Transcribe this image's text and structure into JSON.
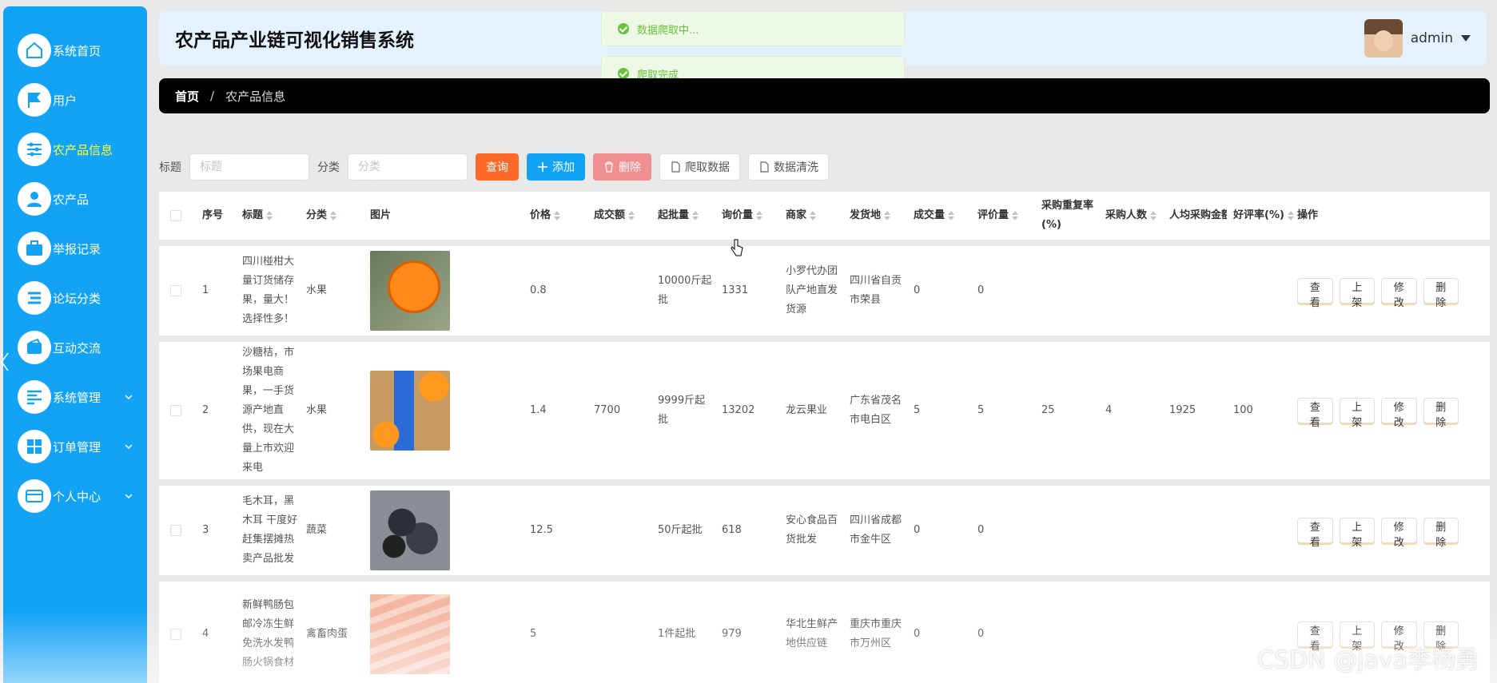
{
  "app": {
    "title": "农产品产业链可视化销售系统"
  },
  "user": {
    "name": "admin"
  },
  "sidebar": {
    "items": [
      {
        "label": "系统首页",
        "icon": "home-icon"
      },
      {
        "label": "用户",
        "icon": "flag-icon"
      },
      {
        "label": "农产品信息",
        "icon": "sliders-icon",
        "active": true
      },
      {
        "label": "农产品",
        "icon": "person-icon"
      },
      {
        "label": "举报记录",
        "icon": "briefcase-icon"
      },
      {
        "label": "论坛分类",
        "icon": "list-icon"
      },
      {
        "label": "互动交流",
        "icon": "wallet-icon"
      },
      {
        "label": "系统管理",
        "icon": "menu-icon",
        "expandable": true
      },
      {
        "label": "订单管理",
        "icon": "grid-icon",
        "expandable": true
      },
      {
        "label": "个人中心",
        "icon": "card-icon",
        "expandable": true
      }
    ]
  },
  "breadcrumb": {
    "home": "首页",
    "sep": "/",
    "current": "农产品信息"
  },
  "toasts": [
    {
      "text": "数据爬取中..."
    },
    {
      "text": "爬取完成"
    }
  ],
  "search": {
    "title_label": "标题",
    "title_placeholder": "标题",
    "category_label": "分类",
    "category_placeholder": "分类",
    "query": "查询",
    "add": "添加",
    "delete": "删除",
    "crawl": "爬取数据",
    "clean": "数据清洗"
  },
  "table": {
    "headers": {
      "no": "序号",
      "title": "标题",
      "category": "分类",
      "image": "图片",
      "price": "价格",
      "deal_amount": "成交额",
      "min_batch": "起批量",
      "inquiries": "询价量",
      "merchant": "商家",
      "ship_from": "发货地",
      "volume": "成交量",
      "reviews": "评价量",
      "repurchase": "采购重复率(%)",
      "buyers": "采购人数",
      "avg_amount": "人均采购金额",
      "good_rate": "好评率(%)",
      "ops": "操作"
    },
    "ops": {
      "view": "查看",
      "shelf": "上架",
      "edit": "修改",
      "delete": "删除"
    },
    "rows": [
      {
        "no": "1",
        "title": "四川椪柑大量订货储存果，量大！选择性多！",
        "category": "水果",
        "price": "0.8",
        "deal_amount": "",
        "min_batch": "10000斤起批",
        "inquiries": "1331",
        "merchant": "小罗代办团队产地直发货源",
        "ship_from": "四川省自贡市荣县",
        "volume": "0",
        "reviews": "0",
        "repurchase": "",
        "buyers": "",
        "avg_amount": "",
        "good_rate": "",
        "img": "orange"
      },
      {
        "no": "2",
        "title": "沙糖桔，市场果电商果，一手货源产地直供，现在大量上市欢迎来电",
        "category": "水果",
        "price": "1.4",
        "deal_amount": "7700",
        "min_batch": "9999斤起批",
        "inquiries": "13202",
        "merchant": "龙云果业",
        "ship_from": "广东省茂名市电白区",
        "volume": "5",
        "reviews": "5",
        "repurchase": "25",
        "buyers": "4",
        "avg_amount": "1925",
        "good_rate": "100",
        "img": "tangerine"
      },
      {
        "no": "3",
        "title": "毛木耳，黑木耳 干度好赶集摆摊热卖产品批发",
        "category": "蔬菜",
        "price": "12.5",
        "deal_amount": "",
        "min_batch": "50斤起批",
        "inquiries": "618",
        "merchant": "安心食品百货批发",
        "ship_from": "四川省成都市金牛区",
        "volume": "0",
        "reviews": "0",
        "repurchase": "",
        "buyers": "",
        "avg_amount": "",
        "good_rate": "",
        "img": "fungus"
      },
      {
        "no": "4",
        "title": "新鲜鸭肠包邮冷冻生鲜免洗水发鸭肠火锅食材",
        "category": "禽畜肉蛋",
        "price": "5",
        "deal_amount": "",
        "min_batch": "1件起批",
        "inquiries": "979",
        "merchant": "华北生鲜产地供应链",
        "ship_from": "重庆市重庆市万州区",
        "volume": "0",
        "reviews": "0",
        "repurchase": "",
        "buyers": "",
        "avg_amount": "",
        "good_rate": "",
        "img": "duck"
      }
    ]
  },
  "watermark": "CSDN @java李杨勇",
  "colors": {
    "sidebar": "#12a3f5",
    "active_text": "#ffff33",
    "query_btn": "#ff6a2b",
    "delete_btn": "#f08f8f",
    "toast_text": "#67c23a"
  }
}
